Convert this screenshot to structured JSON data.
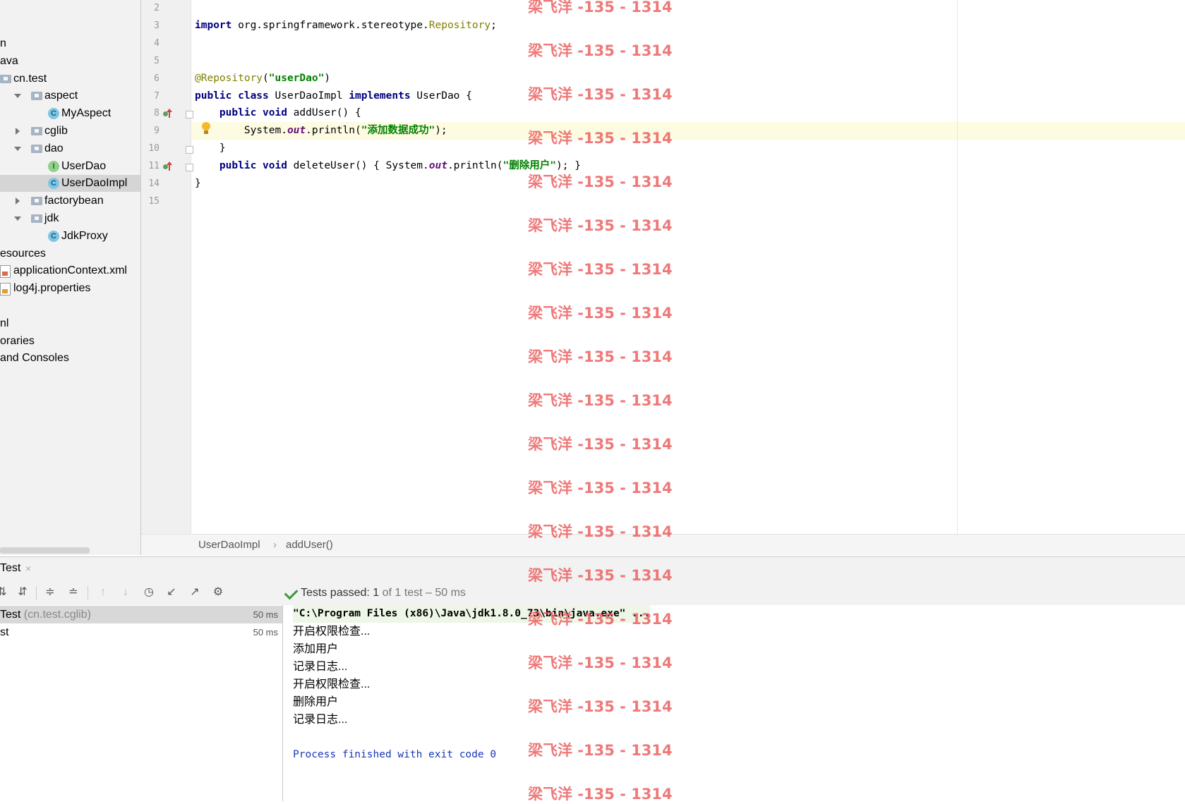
{
  "project_tree": {
    "items": [
      {
        "label": "n",
        "depth": 0
      },
      {
        "label": "ava",
        "depth": 0
      },
      {
        "label": "cn.test",
        "depth": 0,
        "icon": "package-folder-icon"
      },
      {
        "label": "aspect",
        "depth": 1,
        "icon": "package-folder-icon",
        "expanded": true
      },
      {
        "label": "MyAspect",
        "depth": 2,
        "icon": "class-icon",
        "badge": "C"
      },
      {
        "label": "cglib",
        "depth": 1,
        "icon": "package-folder-icon",
        "expanded": false
      },
      {
        "label": "dao",
        "depth": 1,
        "icon": "package-folder-icon",
        "expanded": true
      },
      {
        "label": "UserDao",
        "depth": 2,
        "icon": "interface-icon",
        "badge": "I"
      },
      {
        "label": "UserDaoImpl",
        "depth": 2,
        "icon": "class-icon",
        "badge": "C",
        "selected": true
      },
      {
        "label": "factorybean",
        "depth": 1,
        "icon": "package-folder-icon",
        "expanded": false
      },
      {
        "label": "jdk",
        "depth": 1,
        "icon": "package-folder-icon",
        "expanded": true
      },
      {
        "label": "JdkProxy",
        "depth": 2,
        "icon": "class-icon",
        "badge": "C"
      },
      {
        "label": "esources",
        "depth": 0
      },
      {
        "label": "applicationContext.xml",
        "depth": 0,
        "icon": "xml-file-icon"
      },
      {
        "label": "log4j.properties",
        "depth": 0,
        "icon": "properties-file-icon"
      },
      {
        "label": "",
        "depth": 0
      },
      {
        "label": "nl",
        "depth": 0
      },
      {
        "label": "oraries",
        "depth": 0
      },
      {
        "label": "and Consoles",
        "depth": 0
      }
    ]
  },
  "editor": {
    "lines": [
      {
        "no": "2",
        "segments": []
      },
      {
        "no": "3",
        "segments": [
          {
            "t": "import",
            "c": "kw"
          },
          {
            "t": " org.springframework.stereotype."
          },
          {
            "t": "Repository",
            "c": "ann"
          },
          {
            "t": ";"
          }
        ]
      },
      {
        "no": "4",
        "segments": []
      },
      {
        "no": "5",
        "segments": []
      },
      {
        "no": "6",
        "segments": [
          {
            "t": "@Repository",
            "c": "ann"
          },
          {
            "t": "("
          },
          {
            "t": "\"userDao\"",
            "c": "str"
          },
          {
            "t": ")"
          }
        ]
      },
      {
        "no": "7",
        "segments": [
          {
            "t": "public class",
            "c": "kw"
          },
          {
            "t": " UserDaoImpl "
          },
          {
            "t": "implements",
            "c": "kw"
          },
          {
            "t": " UserDao {"
          }
        ]
      },
      {
        "no": "8",
        "segments": [
          {
            "t": "    "
          },
          {
            "t": "public void",
            "c": "kw"
          },
          {
            "t": " addUser() {"
          }
        ]
      },
      {
        "no": "9",
        "segments": [
          {
            "t": "        System."
          },
          {
            "t": "out",
            "c": "fld"
          },
          {
            "t": ".println("
          },
          {
            "t": "\"添加数据成功\"",
            "c": "str"
          },
          {
            "t": ");"
          }
        ]
      },
      {
        "no": "10",
        "segments": [
          {
            "t": "    }"
          }
        ]
      },
      {
        "no": "11",
        "segments": [
          {
            "t": "    "
          },
          {
            "t": "public void",
            "c": "kw"
          },
          {
            "t": " deleteUser() { System."
          },
          {
            "t": "out",
            "c": "fld"
          },
          {
            "t": ".println("
          },
          {
            "t": "\"删除用户\"",
            "c": "str"
          },
          {
            "t": "); }"
          }
        ]
      },
      {
        "no": "14",
        "segments": [
          {
            "t": "}"
          }
        ]
      },
      {
        "no": "15",
        "segments": []
      }
    ],
    "breadcrumb": [
      "UserDaoImpl",
      "addUser()"
    ],
    "breadcrumb_separator": "›"
  },
  "run_window": {
    "tab_label": "Test",
    "tab_close": "×",
    "status_prefix": "Tests passed: ",
    "status_count": "1",
    "status_suffix": " of 1 test – 50 ms",
    "test_rows": [
      {
        "name": "Test",
        "pkg": " (cn.test.cglib)",
        "duration": "50 ms",
        "selected": true
      },
      {
        "name": "st",
        "pkg": "",
        "duration": "50 ms",
        "selected": false
      }
    ],
    "console_lines": [
      {
        "text": "\"C:\\Program Files (x86)\\Java\\jdk1.8.0_73\\bin\\java.exe\" ...",
        "kind": "cmd"
      },
      {
        "text": "开启权限检查...",
        "kind": "out"
      },
      {
        "text": "添加用户",
        "kind": "out"
      },
      {
        "text": "记录日志...",
        "kind": "out"
      },
      {
        "text": "开启权限检查...",
        "kind": "out"
      },
      {
        "text": "删除用户",
        "kind": "out"
      },
      {
        "text": "记录日志...",
        "kind": "out"
      },
      {
        "text": "",
        "kind": "out"
      },
      {
        "text": "Process finished with exit code 0",
        "kind": "exit"
      }
    ]
  },
  "watermark": "梁飞洋 -135 - 1314",
  "colors": {
    "keyword": "#000080",
    "annotation": "#808000",
    "string": "#008000",
    "field": "#660e7a",
    "watermark": "#eb5a5a",
    "exit_text": "#1a36b8"
  }
}
